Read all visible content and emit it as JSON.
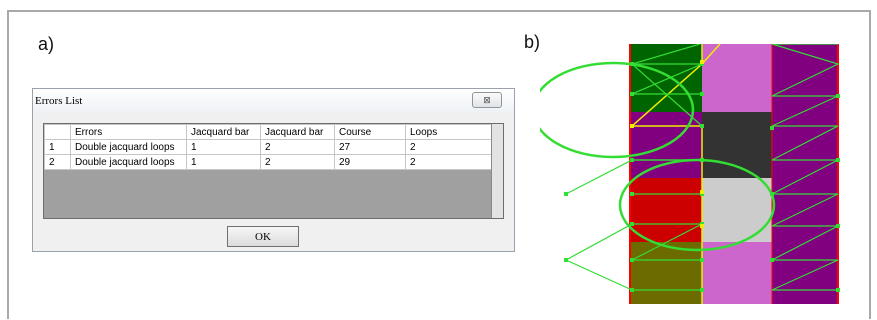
{
  "labels": {
    "a": "a)",
    "b": "b)"
  },
  "dialog": {
    "title": "Errors List",
    "close_glyph": "⊠",
    "ok_label": "OK",
    "columns": [
      "",
      "Errors",
      "Jacquard bar",
      "Jacquard bar",
      "Course",
      "Loops"
    ],
    "rows": [
      [
        "1",
        "Double jacquard loops",
        "1",
        "2",
        "27",
        "2"
      ],
      [
        "2",
        "Double jacquard loops",
        "1",
        "2",
        "29",
        "2"
      ]
    ]
  },
  "diagram": {
    "colors": {
      "dark_green": "#006400",
      "pink": "#cc66cc",
      "purple": "#800080",
      "dark_gray": "#333333",
      "red": "#cc0000",
      "light_gray": "#cccccc",
      "olive": "#6b6b00",
      "line_green": "#33dd33",
      "line_yellow": "#eeee00",
      "border_red": "#ff0000"
    }
  }
}
